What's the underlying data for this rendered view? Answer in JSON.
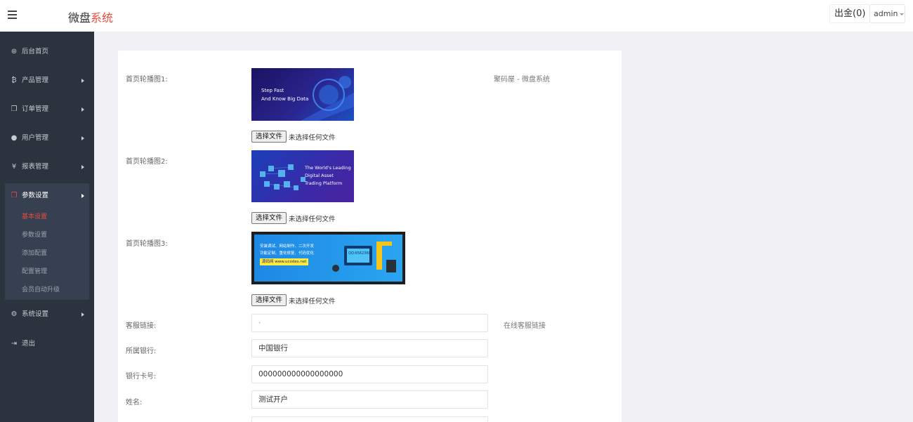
{
  "header": {
    "logo_main": "微盘",
    "logo_accent": "系统",
    "chujin_label": "出金(0)",
    "user_label": "admin"
  },
  "sidebar": {
    "items": [
      {
        "icon": "dashboard-icon",
        "glyph": "⊛",
        "label": "后台首页"
      },
      {
        "icon": "bitcoin-icon",
        "glyph": "₿",
        "label": "产品管理"
      },
      {
        "icon": "copy-icon",
        "glyph": "❐",
        "label": "订单管理"
      },
      {
        "icon": "user-icon",
        "glyph": "●",
        "label": "用户管理"
      },
      {
        "icon": "yen-icon",
        "glyph": "¥",
        "label": "报表管理"
      },
      {
        "icon": "files-icon",
        "glyph": "❐",
        "label": "参数设置"
      },
      {
        "icon": "cogs-icon",
        "glyph": "⚙",
        "label": "系统设置"
      },
      {
        "icon": "sign-out-icon",
        "glyph": "⇥",
        "label": "退出"
      }
    ],
    "sub_items": [
      "基本设置",
      "参数设置",
      "添加配置",
      "配置管理",
      "会员自动升级"
    ]
  },
  "form": {
    "banner1_label": "首页轮播图1:",
    "banner1_note": "聚码屋 - 微盘系统",
    "banner1_text": [
      "Step Fast",
      "And Know Big Data"
    ],
    "banner2_label": "首页轮播图2:",
    "banner2_text": [
      "The World's Leading",
      "Digital Asset",
      "Trading Platform"
    ],
    "banner3_label": "首页轮播图3:",
    "banner3_text": [
      "安装调试、网站制作、二次开发",
      "功能定制、重化修复、代码优化",
      "源码网 www.ucodes.net",
      "QQ:6562360"
    ],
    "file_button": "选择文件",
    "no_file": "未选择任何文件",
    "service_label": "客服链接:",
    "service_value": "·",
    "service_note": "在线客服链接",
    "bank_label": "所属银行:",
    "bank_value": "中国银行",
    "card_label": "银行卡号:",
    "card_value": "000000000000000000",
    "name_label": "姓名:",
    "name_value": "测试开户"
  }
}
